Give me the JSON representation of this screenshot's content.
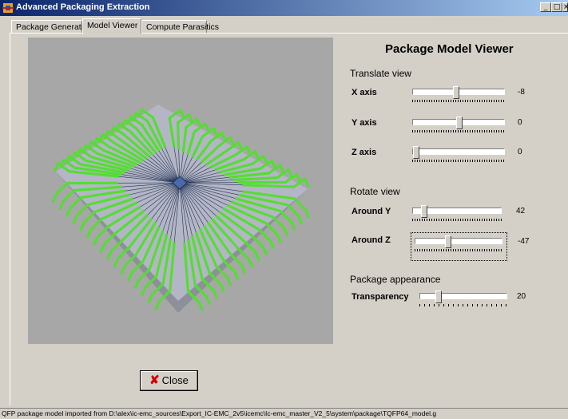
{
  "window": {
    "title": "Advanced Packaging Extraction",
    "accent": "#0a246a"
  },
  "tabs": [
    {
      "label": "Package Generation"
    },
    {
      "label": "Model Viewer"
    },
    {
      "label": "Compute Parasitics"
    }
  ],
  "viewer": {
    "heading": "Package Model Viewer",
    "translate": {
      "title": "Translate view",
      "x": {
        "label": "X axis",
        "value": "-8"
      },
      "y": {
        "label": "Y axis",
        "value": "0"
      },
      "z": {
        "label": "Z axis",
        "value": "0"
      }
    },
    "rotate": {
      "title": "Rotate view",
      "y": {
        "label": "Around Y",
        "value": "42"
      },
      "z": {
        "label": "Around Z",
        "value": "-47"
      }
    },
    "appearance": {
      "title": "Package appearance",
      "transparency": {
        "label": "Transparency",
        "value": "20"
      }
    },
    "model_colors": {
      "body": "#b4b6c6",
      "leads": "#55dd33",
      "wires": "#223355",
      "die": "#4b6aa8"
    }
  },
  "close_label": "Close",
  "status": "QFP package model imported from D:\\alex\\ic-emc_sources\\Export_IC-EMC_2v5\\icemc\\Ic-emc_master_V2_5\\system\\package\\TQFP64_model.g"
}
